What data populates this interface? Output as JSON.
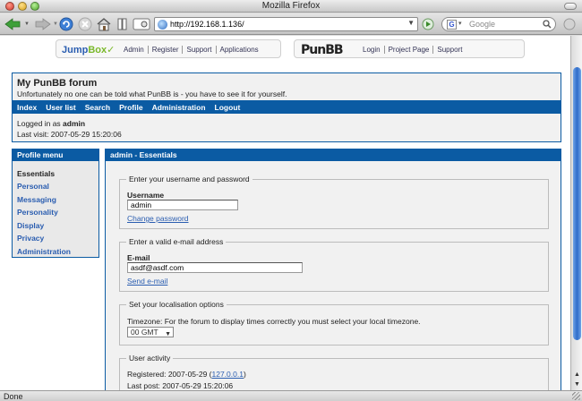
{
  "window": {
    "title": "Mozilla Firefox"
  },
  "toolbar": {
    "url": "http://192.168.1.136/",
    "search_placeholder": "Google"
  },
  "status": {
    "text": "Done"
  },
  "jumpbox": {
    "logo_left": "Jump",
    "logo_right": "Box",
    "links": [
      "Admin",
      "Register",
      "Support",
      "Applications"
    ]
  },
  "punbb_bar": {
    "logo": "PunBB",
    "links": [
      "Login",
      "Project Page",
      "Support"
    ]
  },
  "forum": {
    "title": "My PunBB forum",
    "description": "Unfortunately no one can be told what PunBB is - you have to see it for yourself.",
    "nav": [
      "Index",
      "User list",
      "Search",
      "Profile",
      "Administration",
      "Logout"
    ],
    "logged_in_prefix": "Logged in as ",
    "logged_in_user": "admin",
    "last_visit": "Last visit: 2007-05-29 15:20:06"
  },
  "profile_menu": {
    "title": "Profile menu",
    "items": [
      "Essentials",
      "Personal",
      "Messaging",
      "Personality",
      "Display",
      "Privacy",
      "Administration"
    ]
  },
  "essentials": {
    "title": "admin - Essentials",
    "username_section": {
      "legend": "Enter your username and password",
      "label": "Username",
      "value": "admin",
      "link": "Change password"
    },
    "email_section": {
      "legend": "Enter a valid e-mail address",
      "label": "E-mail",
      "value": "asdf@asdf.com",
      "link": "Send e-mail"
    },
    "locale_section": {
      "legend": "Set your localisation options",
      "timezone_text": "Timezone: For the forum to display times correctly you must select your local timezone.",
      "timezone_value": "00 GMT"
    },
    "activity_section": {
      "legend": "User activity",
      "registered_prefix": "Registered: 2007-05-29 (",
      "registered_ip": "127.0.0.1",
      "registered_suffix": ")",
      "last_post": "Last post: 2007-05-29 15:20:06"
    }
  }
}
